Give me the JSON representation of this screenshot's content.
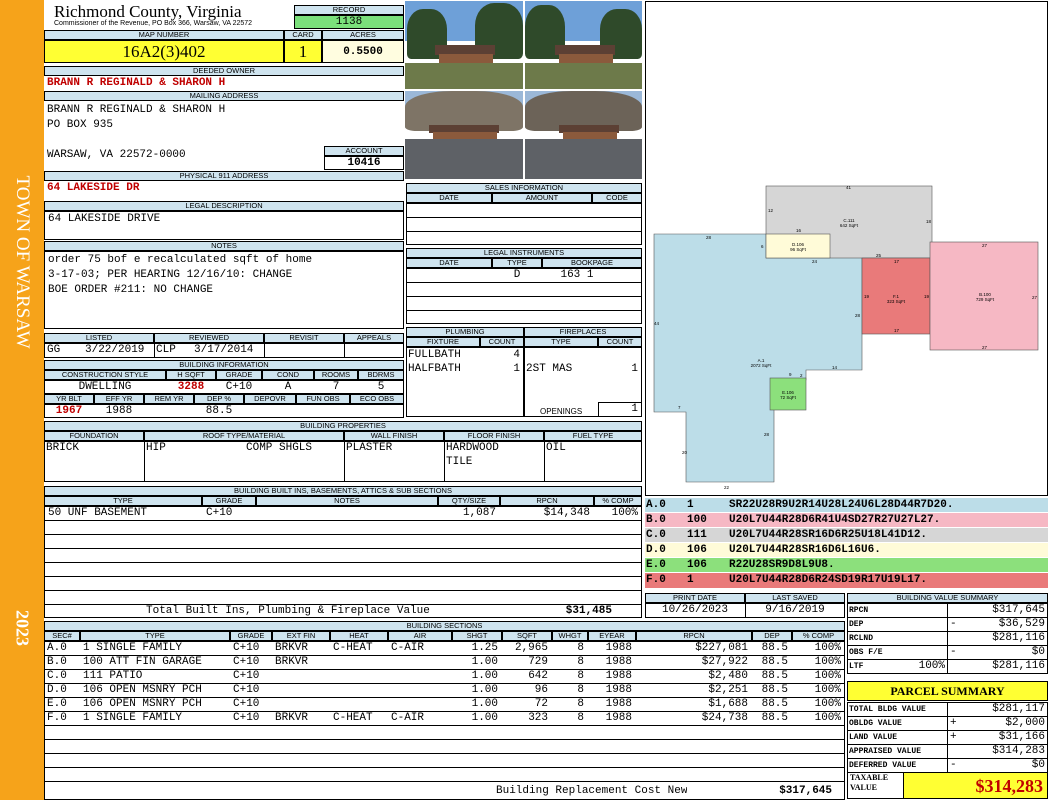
{
  "sidebar": {
    "town": "TOWN OF WARSAW",
    "year": "2023"
  },
  "header": {
    "county": "Richmond County, Virginia",
    "commissioner": "Commissioner of the Revenue, PO Box 366, Warsaw, VA 22572",
    "record_label": "RECORD",
    "record": "1138",
    "map_label": "MAP NUMBER",
    "map_number": "16A2(3)402",
    "card_label": "CARD",
    "card": "1",
    "acres_label": "ACRES",
    "acres": "0.5500"
  },
  "owner": {
    "deeded_label": "DEEDED OWNER",
    "deeded": "BRANN R REGINALD & SHARON H",
    "mailing_label": "MAILING ADDRESS",
    "mailing_lines": [
      "BRANN R REGINALD & SHARON H",
      "PO BOX 935",
      "",
      "WARSAW, VA 22572-0000"
    ],
    "account_label": "ACCOUNT",
    "account": "10416",
    "physical_label": "PHYSICAL 911 ADDRESS",
    "physical": "64 LAKESIDE DR"
  },
  "legal": {
    "label": "LEGAL DESCRIPTION",
    "text": "64 LAKESIDE DRIVE"
  },
  "notes": {
    "label": "NOTES",
    "lines": [
      "order 75 bof e recalculated sqft of home",
      "3-17-03; PER HEARING 12/16/10: CHANGE",
      "BOE ORDER #211: NO CHANGE"
    ]
  },
  "review": {
    "listed_label": "LISTED",
    "reviewed_label": "REVIEWED",
    "revisit_label": "REVISIT",
    "appeals_label": "APPEALS",
    "listed_by": "GG",
    "listed_date": "3/22/2019",
    "reviewed_by": "CLP",
    "reviewed_date": "3/17/2014"
  },
  "building_info": {
    "label": "BUILDING INFORMATION",
    "headers": [
      "CONSTRUCTION STYLE",
      "H SQFT",
      "GRADE",
      "COND",
      "ROOMS",
      "BDRMS"
    ],
    "values": [
      "DWELLING",
      "3288",
      "C+10",
      "A",
      "7",
      "5"
    ],
    "headers2": [
      "YR BLT",
      "EFF YR",
      "REM YR",
      "DEP %",
      "DEPOVR",
      "FUN OBS",
      "ECO OBS"
    ],
    "values2": [
      "1967",
      "1988",
      "",
      "88.5",
      "",
      "",
      ""
    ]
  },
  "sales": {
    "label": "SALES INFORMATION",
    "headers": [
      "DATE",
      "AMOUNT",
      "CODE"
    ]
  },
  "legal_instruments": {
    "label": "LEGAL INSTRUMENTS",
    "headers": [
      "DATE",
      "TYPE",
      "BOOKPAGE"
    ],
    "row": [
      "",
      "D",
      "163 1"
    ]
  },
  "plumbing": {
    "label": "PLUMBING",
    "headers": [
      "FIXTURE",
      "COUNT"
    ],
    "rows": [
      [
        "FULLBATH",
        "4"
      ],
      [
        "HALFBATH",
        "1"
      ]
    ]
  },
  "fireplaces": {
    "label": "FIREPLACES",
    "headers": [
      "TYPE",
      "COUNT"
    ],
    "rows": [
      [
        "2ST MAS",
        "1"
      ]
    ],
    "openings_label": "OPENINGS",
    "openings": "1"
  },
  "building_props": {
    "label": "BUILDING PROPERTIES",
    "headers": [
      "FOUNDATION",
      "ROOF TYPE/MATERIAL",
      "WALL FINISH",
      "FLOOR FINISH",
      "FUEL TYPE"
    ],
    "foundation": "BRICK",
    "roof_type": "HIP",
    "roof_material": "COMP SHGLS",
    "wall": "PLASTER",
    "floor": [
      "HARDWOOD",
      "TILE"
    ],
    "fuel": "OIL"
  },
  "built_ins": {
    "label": "BUILDING BUILT INS, BASEMENTS, ATTICS & SUB SECTIONS",
    "headers": [
      "TYPE",
      "GRADE",
      "NOTES",
      "QTY/SIZE",
      "RPCN",
      "% COMP"
    ],
    "rows": [
      [
        "50 UNF BASEMENT",
        "C+10",
        "",
        "1,087",
        "$14,348",
        "100%"
      ]
    ],
    "total_label": "Total Built Ins, Plumbing & Fireplace Value",
    "total": "$31,485"
  },
  "dates": {
    "print_label": "PRINT DATE",
    "print": "10/26/2023",
    "saved_label": "LAST SAVED",
    "saved": "9/16/2019"
  },
  "sketch_codes": [
    {
      "id": "A.0",
      "n": "1",
      "code": "SR22U28R9U2R14U28L24U6L28D44R7D20.",
      "color": "#bcdde8"
    },
    {
      "id": "B.0",
      "n": "100",
      "code": "U20L7U44R28D6R41U4SD27R27U27L27.",
      "color": "#f6b8c4"
    },
    {
      "id": "C.0",
      "n": "111",
      "code": "U20L7U44R28SR16D6R25U18L41D12.",
      "color": "#d6d6d6"
    },
    {
      "id": "D.0",
      "n": "106",
      "code": "U20L7U44R28SR16D6L16U6.",
      "color": "#fffbd8"
    },
    {
      "id": "E.0",
      "n": "106",
      "code": "R22U28SR9D8L9U8.",
      "color": "#8ce07c"
    },
    {
      "id": "F.0",
      "n": "1",
      "code": "U20L7U44R28D6R24SD19R17U19L17.",
      "color": "#e97a7a"
    }
  ],
  "sketch": {
    "labels": {
      "A": "A.1",
      "A_area": "2072 SqFt",
      "B": "B.100",
      "B_area": "729 SqFt",
      "C": "C.111",
      "C_area": "642 SqFt",
      "D": "D.106",
      "D_area": "96 SqFt",
      "E": "E.106",
      "E_area": "72 SqFt",
      "F": "F.1",
      "F_area": "323 SqFt"
    },
    "dims": [
      "41",
      "18",
      "12",
      "16",
      "6",
      "24",
      "28",
      "25",
      "17",
      "27",
      "27",
      "27",
      "17",
      "19",
      "19",
      "44",
      "28",
      "14",
      "9",
      "2",
      "7",
      "20",
      "22",
      "28"
    ]
  },
  "building_sections": {
    "label": "BUILDING SECTIONS",
    "headers": [
      "SEC#",
      "TYPE",
      "GRADE",
      "EXT FIN",
      "HEAT",
      "AIR",
      "SHGT",
      "SQFT",
      "WHGT",
      "EYEAR",
      "RPCN",
      "DEP",
      "% COMP"
    ],
    "rows": [
      [
        "A.0",
        "1 SINGLE FAMILY",
        "C+10",
        "BRKVR",
        "C-HEAT",
        "C-AIR",
        "1.25",
        "2,965",
        "8",
        "1988",
        "$227,081",
        "88.5",
        "100%"
      ],
      [
        "B.0",
        "100 ATT FIN GARAGE",
        "C+10",
        "BRKVR",
        "",
        "",
        "1.00",
        "729",
        "8",
        "1988",
        "$27,922",
        "88.5",
        "100%"
      ],
      [
        "C.0",
        "111 PATIO",
        "C+10",
        "",
        "",
        "",
        "1.00",
        "642",
        "8",
        "1988",
        "$2,480",
        "88.5",
        "100%"
      ],
      [
        "D.0",
        "106 OPEN MSNRY PCH",
        "C+10",
        "",
        "",
        "",
        "1.00",
        "96",
        "8",
        "1988",
        "$2,251",
        "88.5",
        "100%"
      ],
      [
        "E.0",
        "106 OPEN MSNRY PCH",
        "C+10",
        "",
        "",
        "",
        "1.00",
        "72",
        "8",
        "1988",
        "$1,688",
        "88.5",
        "100%"
      ],
      [
        "F.0",
        "1 SINGLE FAMILY",
        "C+10",
        "BRKVR",
        "C-HEAT",
        "C-AIR",
        "1.00",
        "323",
        "8",
        "1988",
        "$24,738",
        "88.5",
        "100%"
      ]
    ],
    "total_label": "Building Replacement Cost New",
    "total": "$317,645"
  },
  "bvs": {
    "label": "BUILDING VALUE SUMMARY",
    "rows": [
      [
        "RPCN",
        "",
        "",
        "$317,645"
      ],
      [
        "DEP",
        "",
        "-",
        "$36,529"
      ],
      [
        "RCLND",
        "",
        "",
        "$281,116"
      ],
      [
        "OBS F/E",
        "",
        "-",
        "$0"
      ],
      [
        "LTF",
        "100%",
        "",
        "$281,116"
      ]
    ]
  },
  "parcel": {
    "label": "PARCEL SUMMARY",
    "rows": [
      [
        "TOTAL BLDG VALUE",
        "",
        "$281,117"
      ],
      [
        "OBLDG VALUE",
        "+",
        "$2,000"
      ],
      [
        "LAND VALUE",
        "+",
        "$31,166"
      ],
      [
        "APPRAISED VALUE",
        "",
        "$314,283"
      ],
      [
        "DEFERRED VALUE",
        "-",
        "$0"
      ]
    ],
    "taxable_label1": "TAXABLE",
    "taxable_label2": "VALUE",
    "taxable": "$314,283"
  }
}
